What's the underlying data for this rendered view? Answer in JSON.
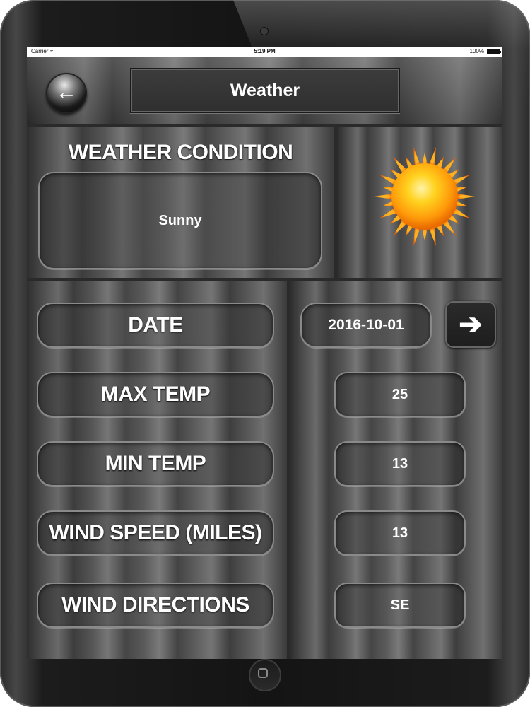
{
  "status_bar": {
    "carrier": "Carrier",
    "time": "5:19 PM",
    "battery": "100%"
  },
  "header": {
    "title": "Weather",
    "back_icon": "left-arrow-icon"
  },
  "condition": {
    "heading": "WEATHER CONDITION",
    "value": "Sunny",
    "icon": "sun-icon"
  },
  "date_row": {
    "label": "DATE",
    "value": "2016-10-01",
    "next_icon": "right-arrow-icon"
  },
  "rows": [
    {
      "label": "MAX TEMP",
      "value": "25"
    },
    {
      "label": "MIN TEMP",
      "value": "13"
    },
    {
      "label": "WIND SPEED (MILES)",
      "value": "13"
    },
    {
      "label": "WIND DIRECTIONS",
      "value": "SE"
    }
  ]
}
